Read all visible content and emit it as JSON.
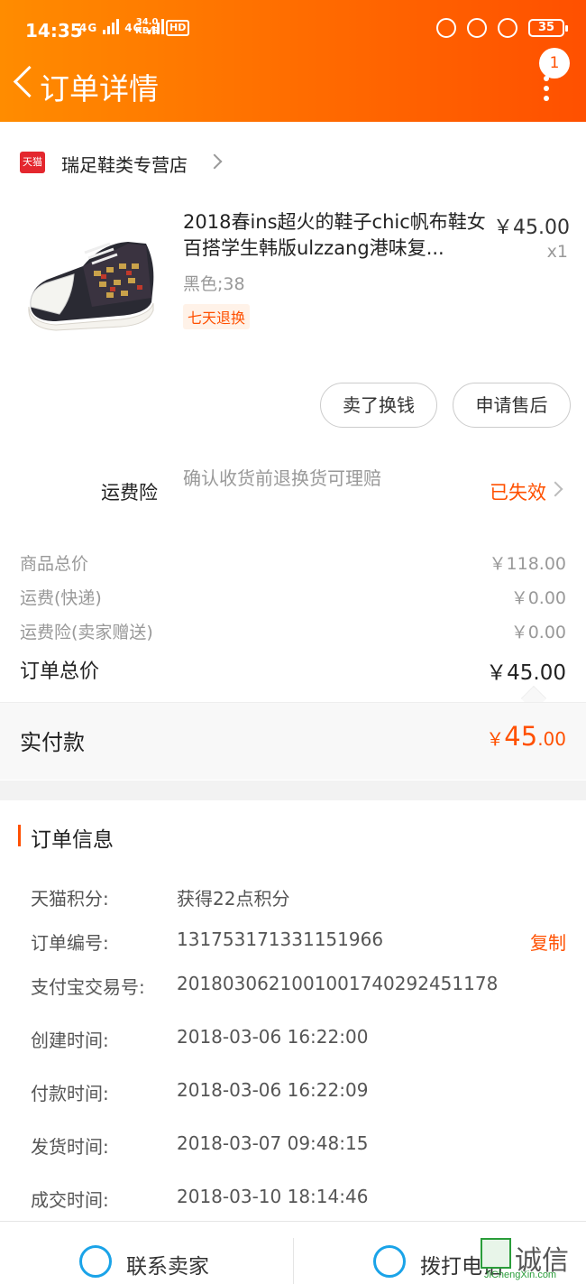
{
  "status_bar": {
    "time": "14:35",
    "network": "4G",
    "network2": "4G",
    "speed_value": "34.0",
    "speed_unit": "KB/S",
    "hd": "HD",
    "battery": "35"
  },
  "header": {
    "title": "订单详情",
    "badge_count": "1"
  },
  "shop": {
    "logo_text": "天猫",
    "name": "瑞足鞋类专营店"
  },
  "product": {
    "title": "2018春ins超火的鞋子chic帆布鞋女百搭学生韩版ulzzang港味复...",
    "price": "￥45.00",
    "quantity": "x1",
    "sku": "黑色;38",
    "tag": "七天退换"
  },
  "actions": {
    "sell_button": "卖了换钱",
    "aftersale_button": "申请售后"
  },
  "insurance": {
    "label": "运费险",
    "description": "确认收货前退换货可理赔",
    "status": "已失效"
  },
  "fees": {
    "goods_label": "商品总价",
    "goods_value": "￥118.00",
    "shipping_label": "运费(快递)",
    "shipping_value": "￥0.00",
    "ins_label": "运费险(卖家赠送)",
    "ins_value": "￥0.00",
    "total_label": "订单总价",
    "total_value": "￥45.00"
  },
  "payment": {
    "label": "实付款",
    "currency": "￥",
    "integer": "45",
    "decimal": ".00"
  },
  "order_info": {
    "title": "订单信息",
    "copy_label": "复制",
    "rows": [
      {
        "key": "天猫积分:",
        "value": "获得22点积分"
      },
      {
        "key": "订单编号:",
        "value": "131753171331151966"
      },
      {
        "key": "支付宝交易号:",
        "value": "2018030621001001740292451178"
      },
      {
        "key": "创建时间:",
        "value": "2018-03-06 16:22:00"
      },
      {
        "key": "付款时间:",
        "value": "2018-03-06 16:22:09"
      },
      {
        "key": "发货时间:",
        "value": "2018-03-07 09:48:15"
      },
      {
        "key": "成交时间:",
        "value": "2018-03-10 18:14:46"
      }
    ]
  },
  "bottom_bar": {
    "contact_seller": "联系卖家",
    "call_phone": "拨打电话"
  },
  "watermark": {
    "text": "诚信",
    "sub": "JiChengXin.com"
  },
  "colors": {
    "accent": "#ff5000",
    "header_start": "#ff8c00",
    "icon_blue": "#1aa3e8"
  }
}
